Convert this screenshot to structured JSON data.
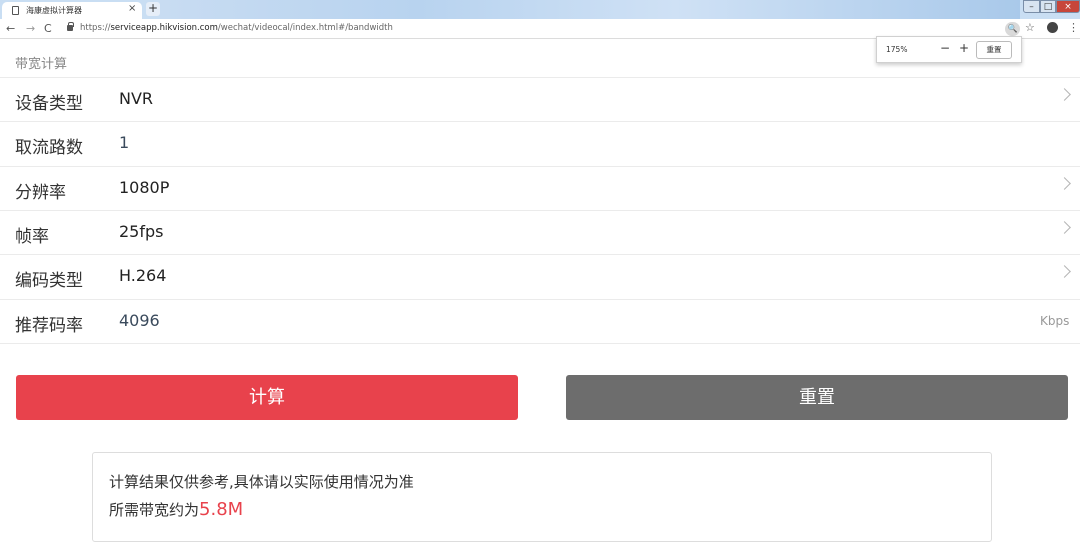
{
  "browser": {
    "tab_title": "海康虚拟计算器",
    "url_prefix": "https://",
    "url_host": "serviceapp.hikvision.com",
    "url_path": "/wechat/videocal/index.html#/bandwidth",
    "zoom_level": "175%",
    "zoom_minus": "−",
    "zoom_plus": "+",
    "zoom_reset": "重置"
  },
  "page": {
    "section_title": "带宽计算",
    "rows": [
      {
        "label": "设备类型",
        "value": "NVR",
        "chevron": true
      },
      {
        "label": "取流路数",
        "value": "1",
        "chevron": false
      },
      {
        "label": "分辨率",
        "value": "1080P",
        "chevron": true
      },
      {
        "label": "帧率",
        "value": "25fps",
        "chevron": true
      },
      {
        "label": "编码类型",
        "value": "H.264",
        "chevron": true
      },
      {
        "label": "推荐码率",
        "value": "4096",
        "unit": "Kbps",
        "chevron": false
      }
    ],
    "calc_button": "计算",
    "reset_button": "重置",
    "result": {
      "note": "计算结果仅供参考,具体请以实际使用情况为准",
      "bandwidth_prefix": "所需带宽约为",
      "bandwidth_value": "5.8M"
    }
  },
  "colors": {
    "accent_red": "#e8424c",
    "reset_gray": "#6d6d6d"
  }
}
